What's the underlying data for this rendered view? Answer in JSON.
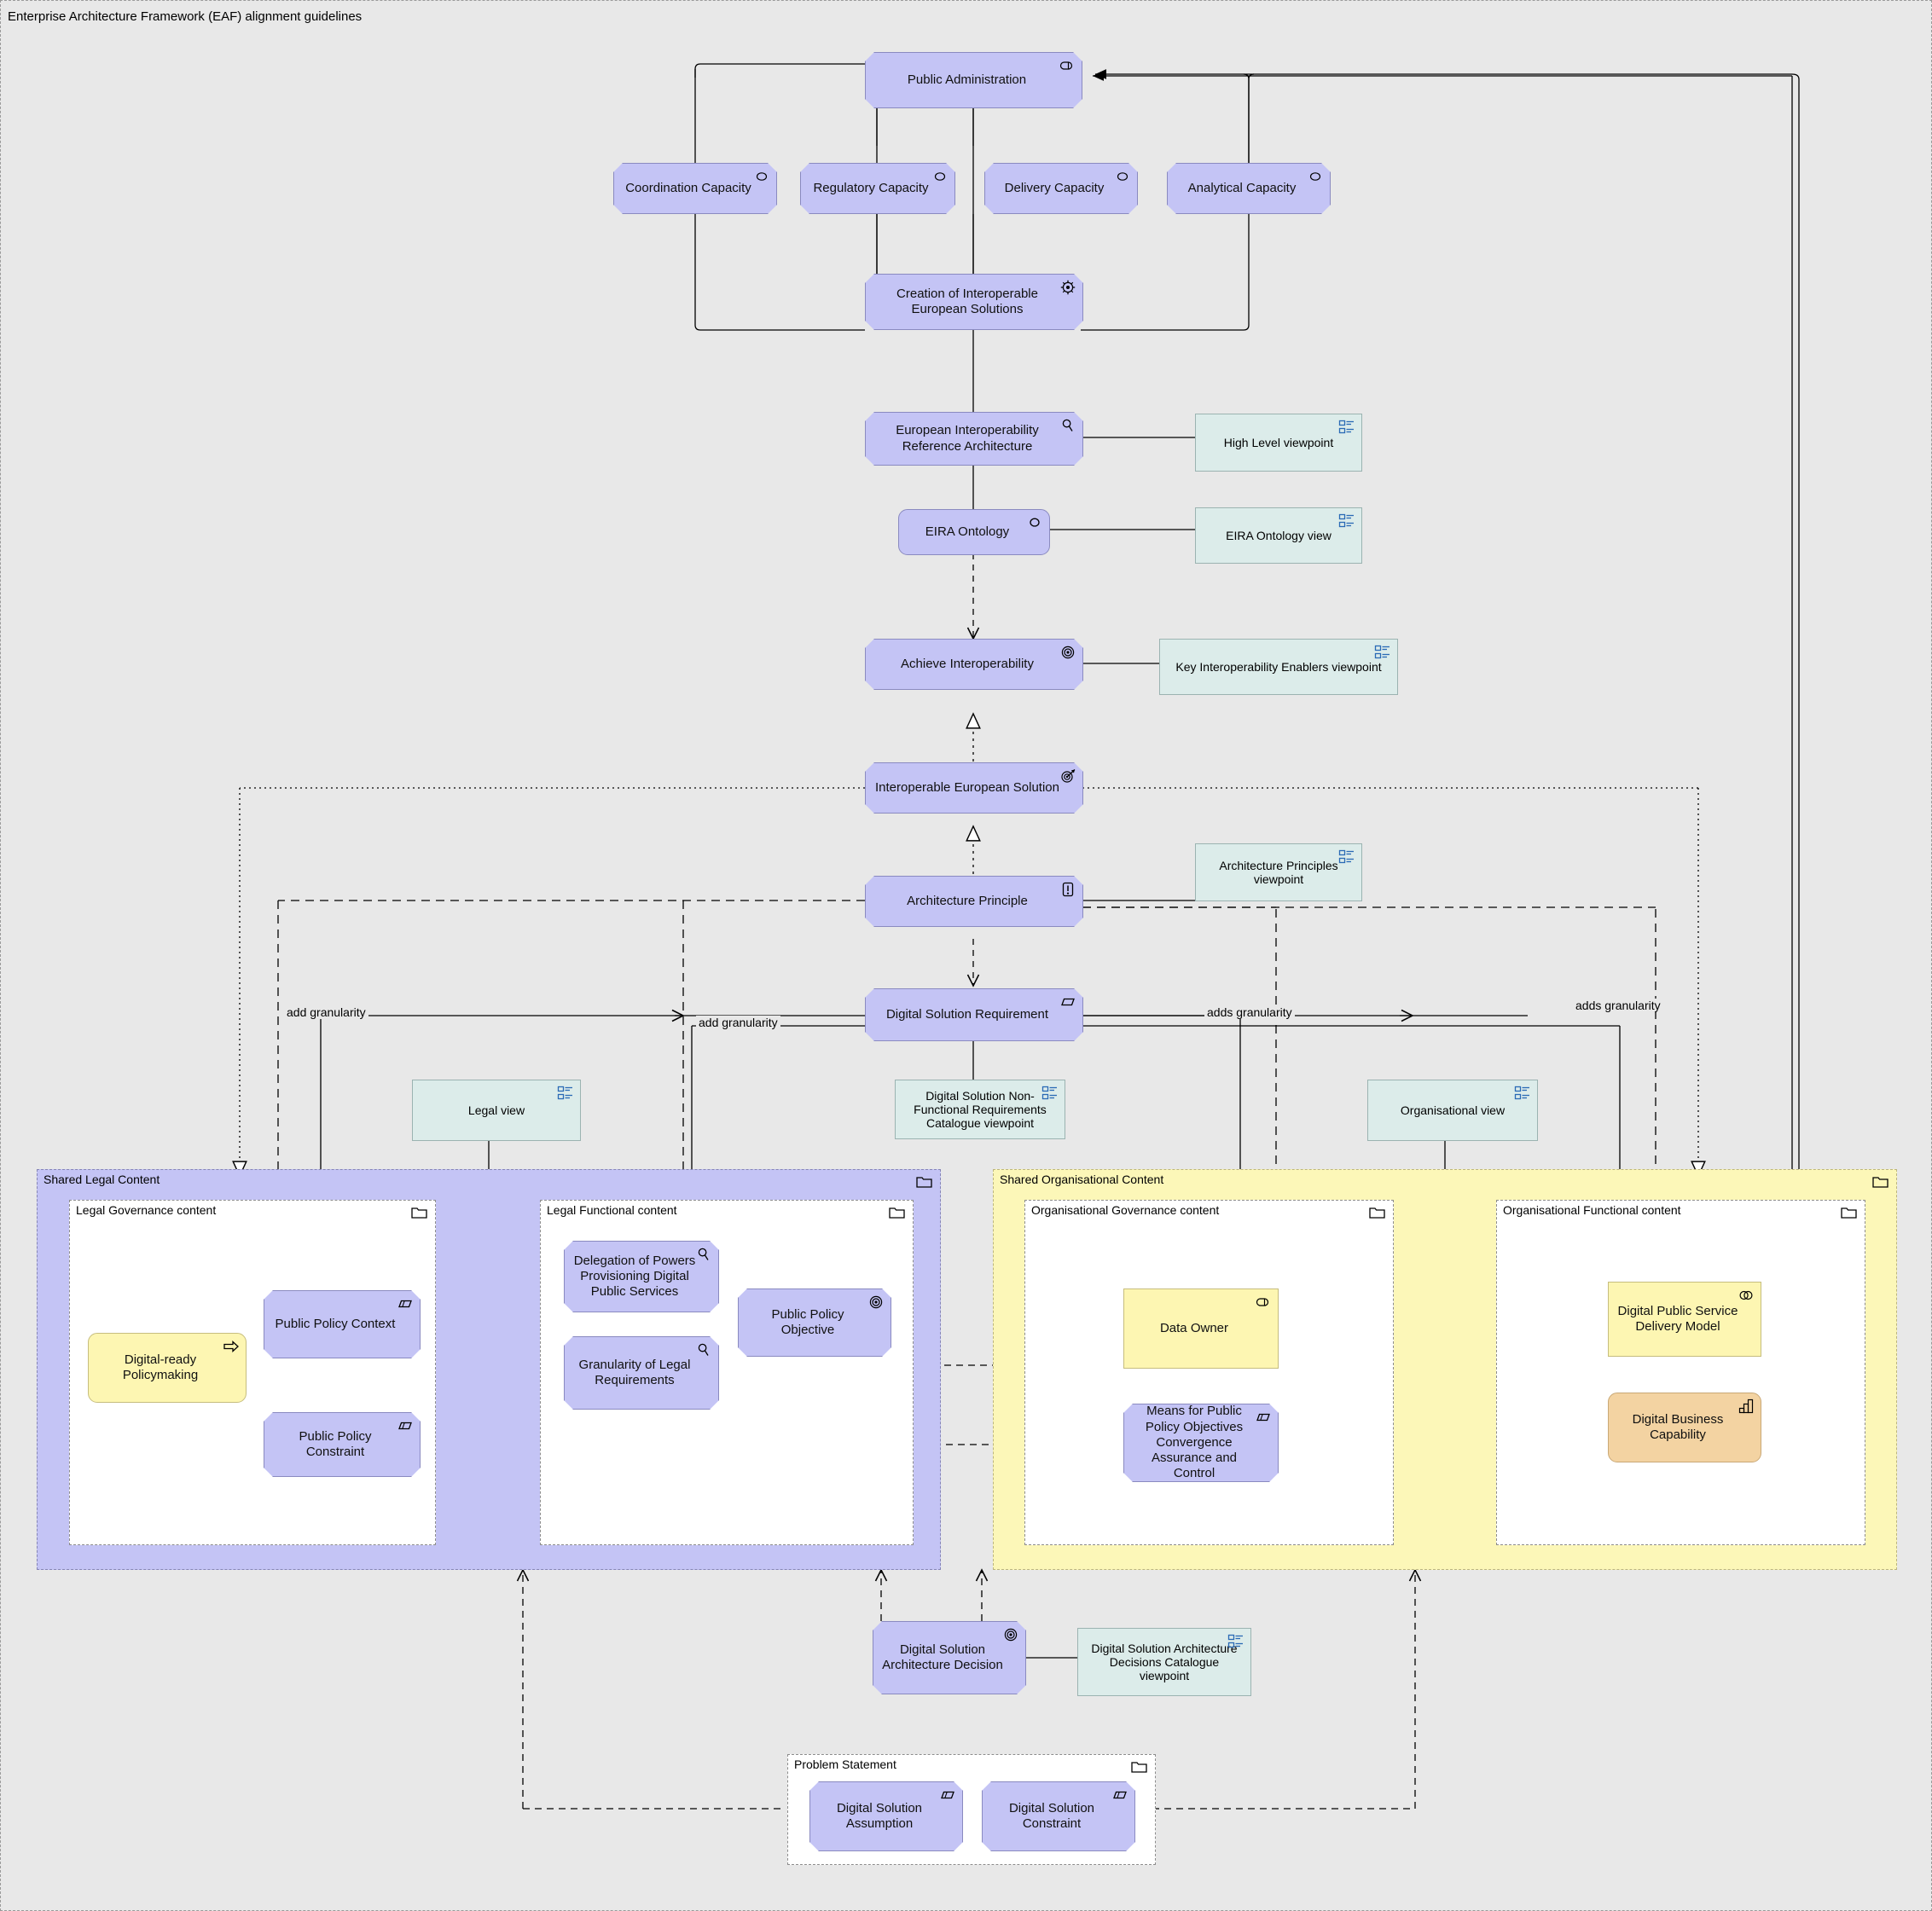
{
  "diagram": {
    "title": "Enterprise Architecture Framework (EAF) alignment guidelines",
    "colors": {
      "canvas": "#e8e8e8",
      "motivation_purple": "#c4c4f5",
      "business_yellow": "#fdf6b2",
      "capability_orange": "#f3d3a2",
      "viewpoint_teal": "#dcecea",
      "legal_group": "#c4c4f5",
      "organisational_group": "#fcf7b8",
      "line": "#000000"
    }
  },
  "nodes": {
    "public_administration": {
      "label": "Public Administration",
      "icon": "business-actor-icon",
      "shape": "octagon",
      "fill": "motivation_purple"
    },
    "coordination_capacity": {
      "label": "Coordination Capacity",
      "icon": "business-role-icon",
      "shape": "octagon",
      "fill": "motivation_purple"
    },
    "regulatory_capacity": {
      "label": "Regulatory Capacity",
      "icon": "business-role-icon",
      "shape": "octagon",
      "fill": "motivation_purple"
    },
    "delivery_capacity": {
      "label": "Delivery Capacity",
      "icon": "business-role-icon",
      "shape": "octagon",
      "fill": "motivation_purple"
    },
    "analytical_capacity": {
      "label": "Analytical Capacity",
      "icon": "business-role-icon",
      "shape": "octagon",
      "fill": "motivation_purple"
    },
    "creation_of_ies": {
      "label": "Creation of Interoperable European Solutions",
      "icon": "driver-icon",
      "shape": "octagon",
      "fill": "motivation_purple"
    },
    "eira": {
      "label": "European Interoperability Reference Architecture",
      "icon": "assessment-icon",
      "shape": "octagon",
      "fill": "motivation_purple"
    },
    "eira_ontology": {
      "label": "EIRA Ontology",
      "icon": "business-object-icon",
      "shape": "rounded",
      "fill": "motivation_purple"
    },
    "achieve_interoperability": {
      "label": "Achieve Interoperability",
      "icon": "goal-icon",
      "shape": "octagon",
      "fill": "motivation_purple"
    },
    "interoperable_european_solution": {
      "label": "Interoperable European Solution",
      "icon": "outcome-icon",
      "shape": "octagon",
      "fill": "motivation_purple"
    },
    "architecture_principle": {
      "label": "Architecture Principle",
      "icon": "principle-icon",
      "shape": "octagon",
      "fill": "motivation_purple"
    },
    "digital_solution_requirement": {
      "label": "Digital Solution Requirement",
      "icon": "requirement-icon",
      "shape": "octagon",
      "fill": "motivation_purple"
    },
    "digital_ready_policymaking": {
      "label": "Digital-ready Policymaking",
      "icon": "course-of-action-icon",
      "shape": "rounded",
      "fill": "business_yellow"
    },
    "public_policy_context": {
      "label": "Public Policy Context",
      "icon": "requirement-icon",
      "shape": "octagon",
      "fill": "motivation_purple"
    },
    "public_policy_constraint": {
      "label": "Public Policy Constraint",
      "icon": "constraint-icon",
      "shape": "octagon",
      "fill": "motivation_purple"
    },
    "delegation_of_powers": {
      "label": "Delegation of Powers Provisioning Digital Public Services",
      "icon": "assessment-icon",
      "shape": "octagon",
      "fill": "motivation_purple"
    },
    "granularity_of_legal_requirements": {
      "label": "Granularity of Legal Requirements",
      "icon": "assessment-icon",
      "shape": "octagon",
      "fill": "motivation_purple"
    },
    "public_policy_objective": {
      "label": "Public Policy Objective",
      "icon": "goal-icon",
      "shape": "octagon",
      "fill": "motivation_purple"
    },
    "data_owner": {
      "label": "Data Owner",
      "icon": "business-actor-icon",
      "shape": "rect",
      "fill": "business_yellow"
    },
    "means_for_ppoc": {
      "label": "Means for Public Policy Objectives Convergence Assurance and Control",
      "icon": "requirement-icon",
      "shape": "octagon",
      "fill": "motivation_purple"
    },
    "digital_public_service_delivery_model": {
      "label": "Digital Public Service Delivery Model",
      "icon": "business-collaboration-icon",
      "shape": "rect",
      "fill": "business_yellow"
    },
    "digital_business_capability": {
      "label": "Digital Business Capability",
      "icon": "capability-icon",
      "shape": "rounded",
      "fill": "capability_orange"
    },
    "digital_solution_architecture_decision": {
      "label": "Digital Solution Architecture Decision",
      "icon": "goal-icon",
      "shape": "octagon",
      "fill": "motivation_purple"
    },
    "digital_solution_assumption": {
      "label": "Digital Solution Assumption",
      "icon": "constraint-icon",
      "shape": "octagon",
      "fill": "motivation_purple"
    },
    "digital_solution_constraint": {
      "label": "Digital Solution Constraint",
      "icon": "constraint-icon",
      "shape": "octagon",
      "fill": "motivation_purple"
    }
  },
  "viewpoints": {
    "high_level": {
      "label": "High Level viewpoint",
      "icon": "viewpoint-icon"
    },
    "eira_ontology_view": {
      "label": "EIRA Ontology view",
      "icon": "viewpoint-icon"
    },
    "key_interoperability_enablers": {
      "label": "Key Interoperability Enablers viewpoint",
      "icon": "viewpoint-icon"
    },
    "architecture_principles": {
      "label": "Architecture Principles viewpoint",
      "icon": "viewpoint-icon"
    },
    "legal_view": {
      "label": "Legal view",
      "icon": "viewpoint-icon"
    },
    "ds_nfr_catalogue": {
      "label": "Digital Solution Non-Functional Requirements Catalogue viewpoint",
      "icon": "viewpoint-icon"
    },
    "organisational_view": {
      "label": "Organisational view",
      "icon": "viewpoint-icon"
    },
    "dsad_catalogue": {
      "label": "Digital Solution Architecture Decisions Catalogue viewpoint",
      "icon": "viewpoint-icon"
    }
  },
  "groups": {
    "shared_legal_content": {
      "label": "Shared Legal Content",
      "icon": "folder-icon"
    },
    "legal_governance_content": {
      "label": "Legal Governance content",
      "icon": "folder-icon"
    },
    "legal_functional_content": {
      "label": "Legal Functional content",
      "icon": "folder-icon"
    },
    "shared_organisational_content": {
      "label": "Shared Organisational Content",
      "icon": "folder-icon"
    },
    "organisational_governance_content": {
      "label": "Organisational Governance content",
      "icon": "folder-icon"
    },
    "organisational_functional_content": {
      "label": "Organisational Functional content",
      "icon": "folder-icon"
    },
    "problem_statement": {
      "label": "Problem Statement",
      "icon": "folder-icon"
    }
  },
  "edge_labels": {
    "add_granularity_1": "add granularity",
    "add_granularity_2": "add granularity",
    "adds_granularity_1": "adds granularity",
    "adds_granularity_2": "adds granularity"
  }
}
